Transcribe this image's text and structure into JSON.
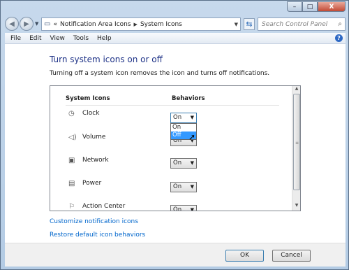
{
  "window": {
    "caption_buttons": {
      "minimize": "–",
      "maximize": "□",
      "close": "X"
    }
  },
  "nav": {
    "back_icon": "back-arrow-icon",
    "forward_icon": "forward-arrow-icon",
    "address_prefix": "«",
    "breadcrumb": [
      "Notification Area Icons",
      "System Icons"
    ],
    "search_placeholder": "Search Control Panel"
  },
  "menu": [
    "File",
    "Edit",
    "View",
    "Tools",
    "Help"
  ],
  "main": {
    "heading": "Turn system icons on or off",
    "description": "Turning off a system icon removes the icon and turns off notifications.",
    "columns": {
      "icons": "System Icons",
      "behaviors": "Behaviors"
    },
    "rows": [
      {
        "name": "Clock",
        "icon": "clock-icon",
        "behavior": "On"
      },
      {
        "name": "Volume",
        "icon": "volume-icon",
        "behavior": "On"
      },
      {
        "name": "Network",
        "icon": "network-icon",
        "behavior": "On"
      },
      {
        "name": "Power",
        "icon": "power-icon",
        "behavior": "On"
      },
      {
        "name": "Action Center",
        "icon": "flag-icon",
        "behavior": "On"
      }
    ],
    "dropdown_open": {
      "row": "Clock",
      "options": [
        "On",
        "Off"
      ],
      "highlighted": "Off"
    },
    "links": {
      "customize": "Customize notification icons",
      "restore": "Restore default icon behaviors"
    }
  },
  "footer": {
    "ok": "OK",
    "cancel": "Cancel"
  },
  "colors": {
    "heading": "#1e3287",
    "link": "#0066cc",
    "highlight": "#3399ff"
  }
}
